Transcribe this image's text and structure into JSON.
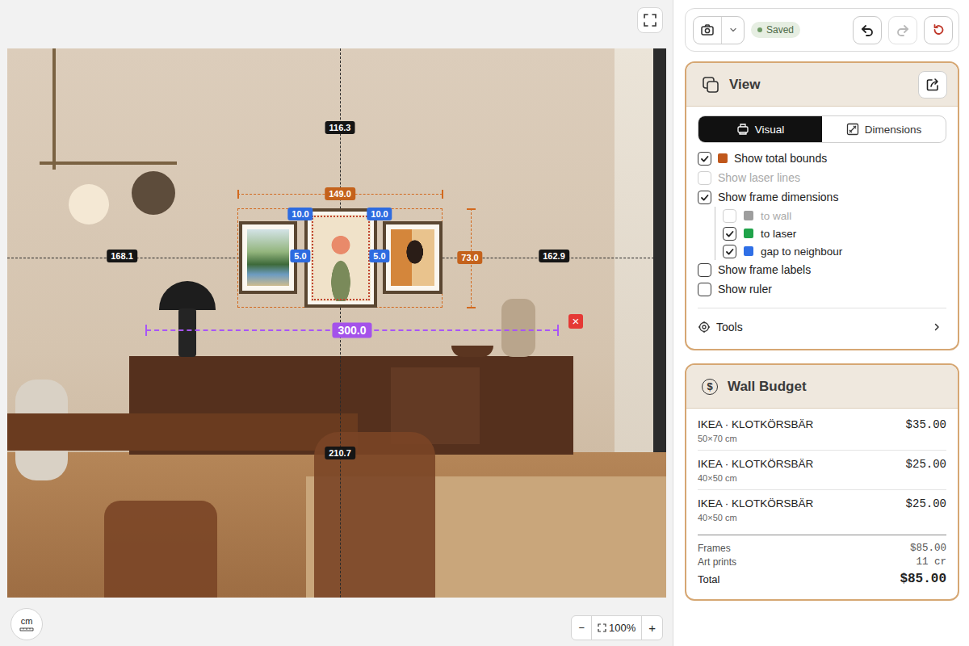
{
  "toolbar": {
    "status": "Saved",
    "buttons": [
      {
        "kind": "undo",
        "disabled": false
      },
      {
        "kind": "redo",
        "disabled": true
      },
      {
        "kind": "reset",
        "disabled": false
      }
    ]
  },
  "canvas": {
    "guides": [
      {
        "kind": "top",
        "text": "116.3"
      },
      {
        "kind": "left",
        "text": "168.1"
      },
      {
        "kind": "right",
        "text": "162.9"
      },
      {
        "kind": "bottom",
        "text": "210.7"
      }
    ],
    "bounds": {
      "width": "149.0",
      "height": "73.0"
    },
    "frames": [
      {
        "kind": "landscape"
      },
      {
        "kind": "vase"
      },
      {
        "kind": "portrait"
      }
    ],
    "gaps": [
      {
        "kind": "top-left",
        "text": "10.0"
      },
      {
        "kind": "top-right",
        "text": "10.0"
      },
      {
        "kind": "mid-left",
        "text": "5.0"
      },
      {
        "kind": "mid-right",
        "text": "5.0"
      }
    ],
    "measure": {
      "text": "300.0",
      "remove": "×"
    }
  },
  "unit_button": "cm",
  "zoom": {
    "minus": "−",
    "value": "100%",
    "plus": "+"
  },
  "view": {
    "title": "View",
    "tabs": [
      {
        "label": "Visual",
        "selected": true
      },
      {
        "label": "Dimensions",
        "selected": false
      }
    ],
    "options": [
      {
        "kind": "main",
        "label": "Show total bounds",
        "checked": true,
        "disabled": false,
        "color": "#c0571b"
      },
      {
        "kind": "main",
        "label": "Show laser lines",
        "checked": false,
        "disabled": true
      },
      {
        "kind": "main",
        "label": "Show frame dimensions",
        "checked": true,
        "disabled": false
      },
      {
        "kind": "sub",
        "label": "to wall",
        "checked": false,
        "disabled": true,
        "color": "#9e9e9e"
      },
      {
        "kind": "sub",
        "label": "to laser",
        "checked": true,
        "disabled": false,
        "color": "#1fa34a"
      },
      {
        "kind": "sub",
        "label": "gap to neighbour",
        "checked": true,
        "disabled": false,
        "color": "#2f6fe6"
      },
      {
        "kind": "main",
        "label": "Show frame labels",
        "checked": false,
        "disabled": false
      },
      {
        "kind": "main",
        "label": "Show ruler",
        "checked": false,
        "disabled": false
      }
    ],
    "tools": "Tools"
  },
  "budget": {
    "icon": "$",
    "title": "Wall Budget",
    "items": [
      {
        "name": "IKEA · KLOTKÖRSBÄR",
        "size": "50×70 cm",
        "price": "$35.00"
      },
      {
        "name": "IKEA · KLOTKÖRSBÄR",
        "size": "40×50 cm",
        "price": "$25.00"
      },
      {
        "name": "IKEA · KLOTKÖRSBÄR",
        "size": "40×50 cm",
        "price": "$25.00"
      }
    ],
    "summary": [
      {
        "label": "Frames",
        "value": "$85.00"
      },
      {
        "label": "Art prints",
        "value": "11 cr"
      }
    ],
    "total": {
      "label": "Total",
      "value": "$85.00"
    }
  }
}
